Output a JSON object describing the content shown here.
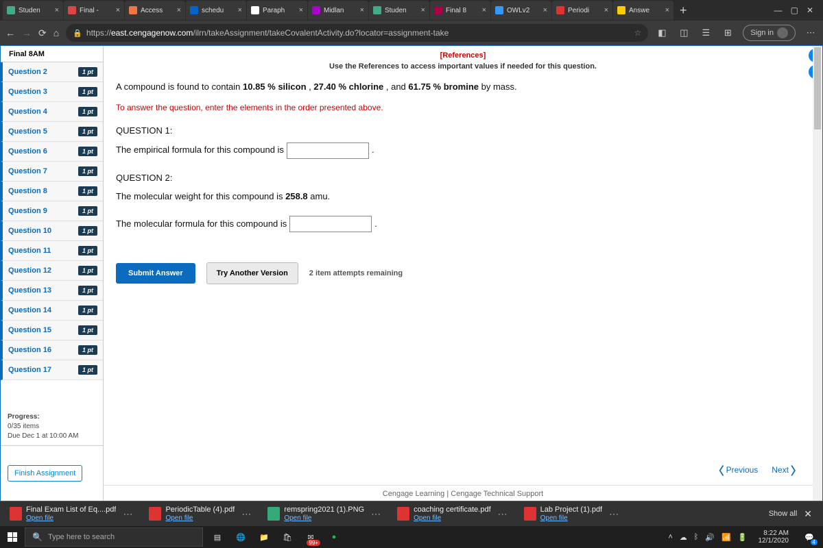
{
  "browser": {
    "tabs": [
      {
        "label": "Studen"
      },
      {
        "label": "Final -"
      },
      {
        "label": "Access"
      },
      {
        "label": "schedu"
      },
      {
        "label": "Paraph"
      },
      {
        "label": "Midlan"
      },
      {
        "label": "Studen"
      },
      {
        "label": "Final 8"
      },
      {
        "label": "OWLv2"
      },
      {
        "label": "Periodi"
      },
      {
        "label": "Answe"
      }
    ],
    "url_prefix": "https://",
    "url_host": "east.cengagenow.com",
    "url_path": "/ilrn/takeAssignment/takeCovalentActivity.do?locator=assignment-take",
    "signin": "Sign in"
  },
  "sidebar": {
    "header": "Final 8AM",
    "questions": [
      {
        "label": "Question 2",
        "pts": "1 pt"
      },
      {
        "label": "Question 3",
        "pts": "1 pt"
      },
      {
        "label": "Question 4",
        "pts": "1 pt"
      },
      {
        "label": "Question 5",
        "pts": "1 pt"
      },
      {
        "label": "Question 6",
        "pts": "1 pt"
      },
      {
        "label": "Question 7",
        "pts": "1 pt"
      },
      {
        "label": "Question 8",
        "pts": "1 pt"
      },
      {
        "label": "Question 9",
        "pts": "1 pt"
      },
      {
        "label": "Question 10",
        "pts": "1 pt"
      },
      {
        "label": "Question 11",
        "pts": "1 pt"
      },
      {
        "label": "Question 12",
        "pts": "1 pt"
      },
      {
        "label": "Question 13",
        "pts": "1 pt"
      },
      {
        "label": "Question 14",
        "pts": "1 pt"
      },
      {
        "label": "Question 15",
        "pts": "1 pt"
      },
      {
        "label": "Question 16",
        "pts": "1 pt"
      },
      {
        "label": "Question 17",
        "pts": "1 pt"
      }
    ],
    "progress_label": "Progress:",
    "progress_count": "0/35 items",
    "due": "Due Dec 1 at 10:00 AM",
    "finish": "Finish Assignment"
  },
  "question": {
    "references": "[References]",
    "hint": "Use the References to access important values if needed for this question.",
    "compound_pre": "A compound is found to contain ",
    "si_pct": "10.85 % silicon",
    "sep1": " , ",
    "cl_pct": "27.40 % chlorine",
    "sep2": " , and ",
    "br_pct": "61.75 % bromine",
    "post": " by mass.",
    "red_instr": "To answer the question, enter the elements in the order presented above.",
    "q1_label": "QUESTION 1:",
    "q1_text": "The empirical formula for this compound is ",
    "q1_after": " .",
    "q2_label": "QUESTION 2:",
    "q2_text_a": "The molecular weight for this compound is ",
    "q2_weight": "258.8",
    "q2_text_b": " amu.",
    "q2_text_c": "The molecular formula for this compound is ",
    "q2_after": " .",
    "submit": "Submit Answer",
    "try": "Try Another Version",
    "attempts": "2 item attempts remaining",
    "prev": "Previous",
    "next": "Next",
    "footer_a": "Cengage Learning",
    "footer_sep": " | ",
    "footer_b": "Cengage Technical Support"
  },
  "downloads": {
    "items": [
      {
        "name": "Final Exam List of Eq....pdf",
        "open": "Open file"
      },
      {
        "name": "PeriodicTable (4).pdf",
        "open": "Open file"
      },
      {
        "name": "remspring2021 (1).PNG",
        "open": "Open file"
      },
      {
        "name": "coaching certificate.pdf",
        "open": "Open file"
      },
      {
        "name": "Lab Project (1).pdf",
        "open": "Open file"
      }
    ],
    "showall": "Show all"
  },
  "taskbar": {
    "search_placeholder": "Type here to search",
    "badge": "99+",
    "time": "8:22 AM",
    "date": "12/1/2020",
    "notif": "4"
  }
}
